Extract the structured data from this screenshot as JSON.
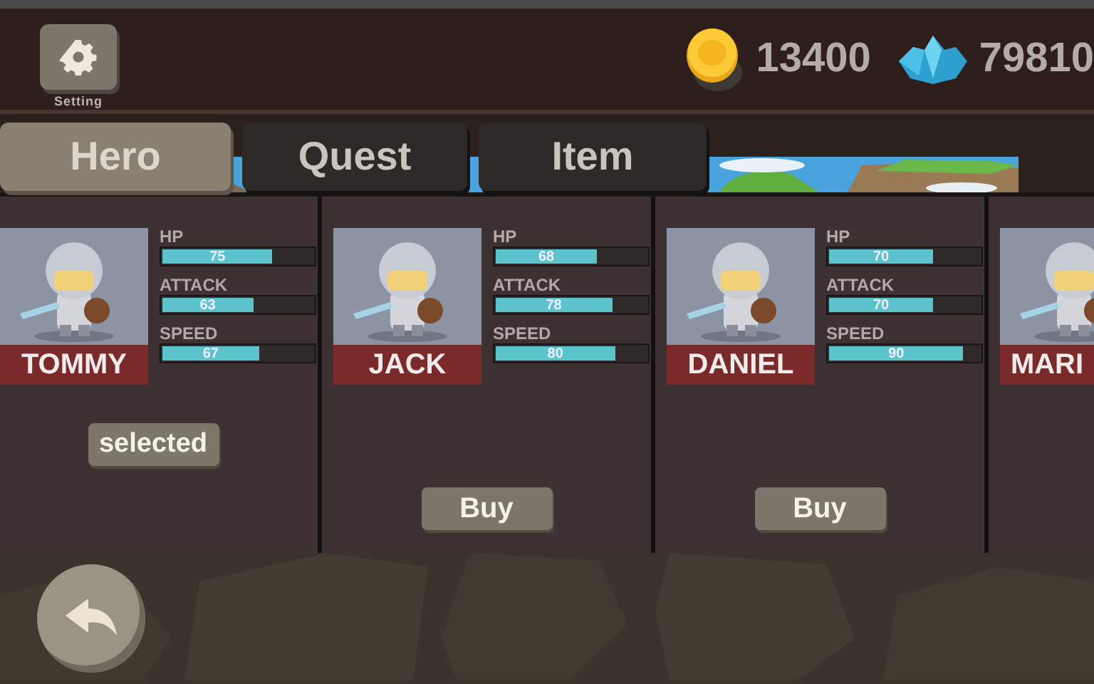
{
  "top_bar": {
    "settings_label": "Setting",
    "currencies": [
      {
        "kind": "coin",
        "amount": "13400"
      },
      {
        "kind": "gem",
        "amount": "79810"
      }
    ]
  },
  "tabs": [
    {
      "label": "Hero",
      "selected": true
    },
    {
      "label": "Quest",
      "selected": false
    },
    {
      "label": "Item",
      "selected": false
    }
  ],
  "heroes": [
    {
      "name": "TOMMY",
      "stats": [
        {
          "name": "HP",
          "level": 0.73,
          "reading": "75"
        },
        {
          "name": "ATTACK",
          "level": 0.6,
          "reading": "63"
        },
        {
          "name": "SPEED",
          "level": 0.64,
          "reading": "67"
        }
      ],
      "button": {
        "kind": "selected",
        "label": "selected"
      }
    },
    {
      "name": "JACK",
      "stats": [
        {
          "name": "HP",
          "level": 0.67,
          "reading": "68"
        },
        {
          "name": "ATTACK",
          "level": 0.77,
          "reading": "78"
        },
        {
          "name": "SPEED",
          "level": 0.79,
          "reading": "80"
        }
      ],
      "button": {
        "kind": "buy",
        "label": "Buy"
      }
    },
    {
      "name": "DANIEL",
      "stats": [
        {
          "name": "HP",
          "level": 0.69,
          "reading": "70"
        },
        {
          "name": "ATTACK",
          "level": 0.69,
          "reading": "70"
        },
        {
          "name": "SPEED",
          "level": 0.89,
          "reading": "90"
        }
      ],
      "button": {
        "kind": "buy",
        "label": "Buy"
      }
    },
    {
      "name": "MARI"
    }
  ]
}
